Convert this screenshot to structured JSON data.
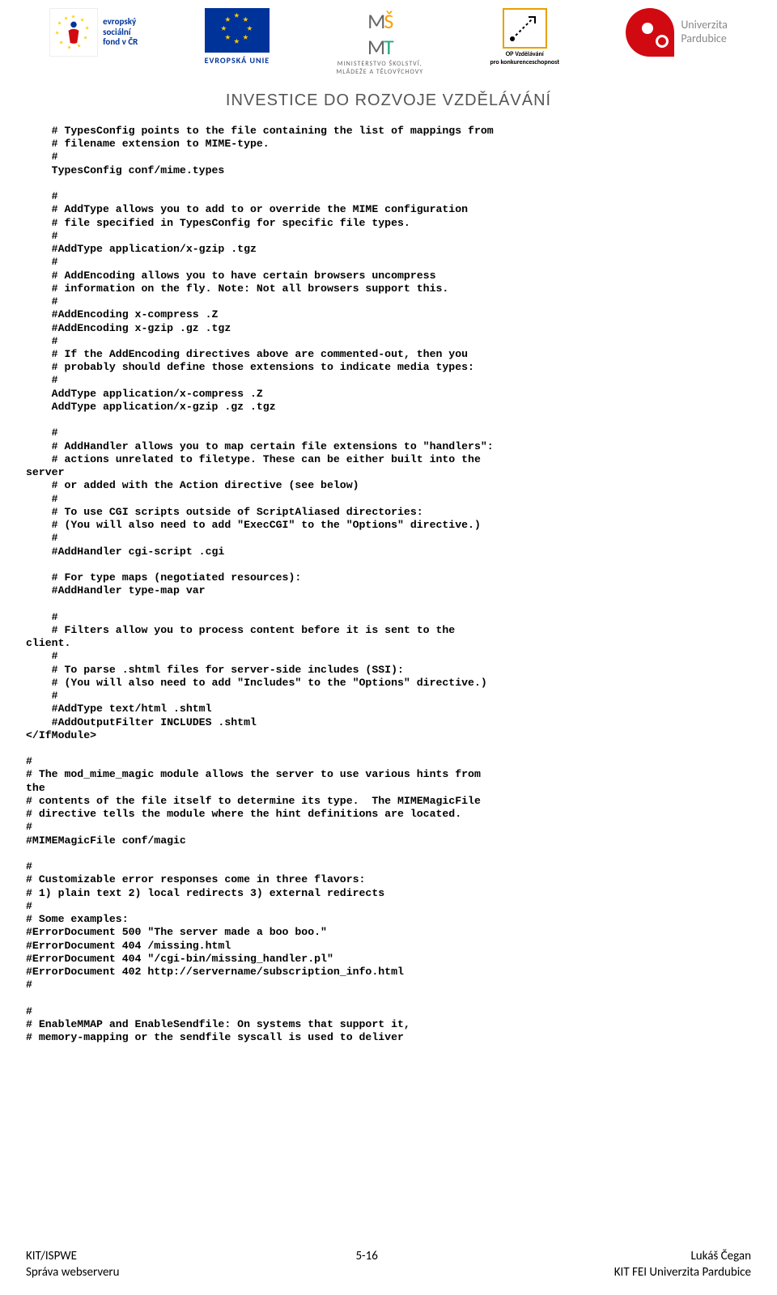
{
  "header": {
    "esf_text": "evropský\nsociální\nfond v ČR",
    "eu_label": "EVROPSKÁ UNIE",
    "msmt_line1": "MINISTERSTVO ŠKOLSTVÍ,",
    "msmt_line2": "MLÁDEŽE A TĚLOVÝCHOVY",
    "op_line1": "OP Vzdělávání",
    "op_line2": "pro konkurenceschopnost",
    "univ_line1": "Univerzita",
    "univ_line2": "Pardubice",
    "banner": "INVESTICE DO ROZVOJE VZDĚLÁVÁNÍ"
  },
  "code": "    # TypesConfig points to the file containing the list of mappings from\n    # filename extension to MIME-type.\n    #\n    TypesConfig conf/mime.types\n\n    #\n    # AddType allows you to add to or override the MIME configuration\n    # file specified in TypesConfig for specific file types.\n    #\n    #AddType application/x-gzip .tgz\n    #\n    # AddEncoding allows you to have certain browsers uncompress\n    # information on the fly. Note: Not all browsers support this.\n    #\n    #AddEncoding x-compress .Z\n    #AddEncoding x-gzip .gz .tgz\n    #\n    # If the AddEncoding directives above are commented-out, then you\n    # probably should define those extensions to indicate media types:\n    #\n    AddType application/x-compress .Z\n    AddType application/x-gzip .gz .tgz\n\n    #\n    # AddHandler allows you to map certain file extensions to \"handlers\":\n    # actions unrelated to filetype. These can be either built into the\nserver\n    # or added with the Action directive (see below)\n    #\n    # To use CGI scripts outside of ScriptAliased directories:\n    # (You will also need to add \"ExecCGI\" to the \"Options\" directive.)\n    #\n    #AddHandler cgi-script .cgi\n\n    # For type maps (negotiated resources):\n    #AddHandler type-map var\n\n    #\n    # Filters allow you to process content before it is sent to the\nclient.\n    #\n    # To parse .shtml files for server-side includes (SSI):\n    # (You will also need to add \"Includes\" to the \"Options\" directive.)\n    #\n    #AddType text/html .shtml\n    #AddOutputFilter INCLUDES .shtml\n</IfModule>\n\n#\n# The mod_mime_magic module allows the server to use various hints from\nthe\n# contents of the file itself to determine its type.  The MIMEMagicFile\n# directive tells the module where the hint definitions are located.\n#\n#MIMEMagicFile conf/magic\n\n#\n# Customizable error responses come in three flavors:\n# 1) plain text 2) local redirects 3) external redirects\n#\n# Some examples:\n#ErrorDocument 500 \"The server made a boo boo.\"\n#ErrorDocument 404 /missing.html\n#ErrorDocument 404 \"/cgi-bin/missing_handler.pl\"\n#ErrorDocument 402 http://servername/subscription_info.html\n#\n\n#\n# EnableMMAP and EnableSendfile: On systems that support it,\n# memory-mapping or the sendfile syscall is used to deliver",
  "footer": {
    "left_line1": "KIT/ISPWE",
    "left_line2": "Správa webserveru",
    "center": "5-16",
    "right_line1": "Lukáš Čegan",
    "right_line2": "KIT FEI Univerzita Pardubice"
  }
}
